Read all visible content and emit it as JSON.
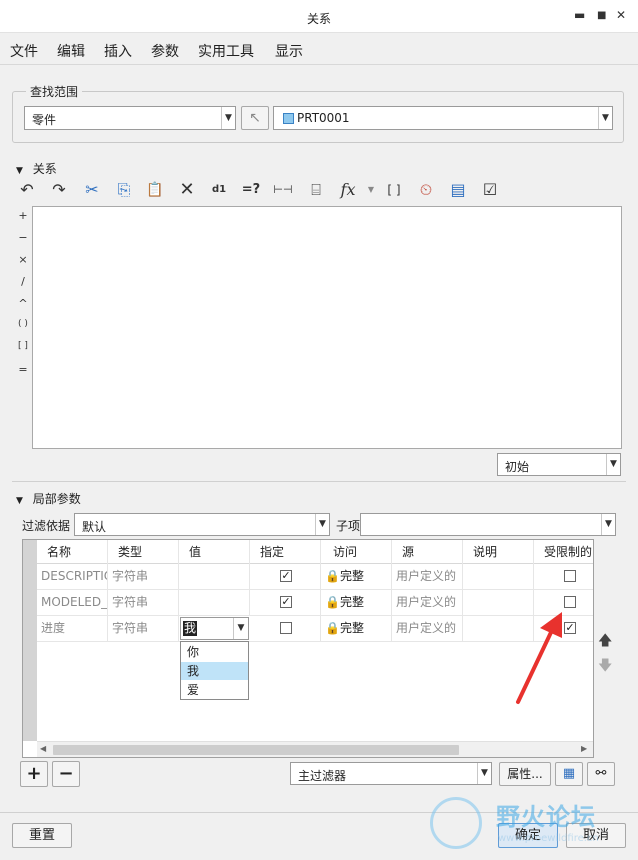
{
  "window": {
    "title": "关系",
    "min": "▬",
    "max": "■",
    "close": "✕"
  },
  "menu": [
    "文件",
    "编辑",
    "插入",
    "参数",
    "实用工具",
    "显示"
  ],
  "scope": {
    "legend": "查找范围",
    "type_value": "零件",
    "model_value": "PRT0001"
  },
  "relations": {
    "title": "关系",
    "toolbar": [
      "↶",
      "↷",
      "✂",
      "⎘",
      "📋",
      "✕",
      "d1",
      "=?",
      "⊢⊣",
      "⌸",
      "fx",
      "[ ]",
      "⏲",
      "▤",
      "☑"
    ],
    "operators": [
      "+",
      "−",
      "×",
      "/",
      "^",
      "( )",
      "[ ]",
      "="
    ],
    "mode_value": "初始"
  },
  "local_params": {
    "title": "局部参数",
    "filter_label": "过滤依据",
    "filter_value": "默认",
    "child_label": "子项",
    "child_value": "",
    "columns": [
      "名称",
      "类型",
      "值",
      "指定",
      "访问",
      "源",
      "说明",
      "受限制的"
    ],
    "rows": [
      {
        "name": "DESCRIPTIO",
        "type": "字符串",
        "value": "",
        "designated": true,
        "access": "完整",
        "source": "用户定义的",
        "desc": "",
        "restricted": false
      },
      {
        "name": "MODELED_",
        "type": "字符串",
        "value": "",
        "designated": true,
        "access": "完整",
        "source": "用户定义的",
        "desc": "",
        "restricted": false
      },
      {
        "name": "进度",
        "type": "字符串",
        "value": "我",
        "designated": false,
        "access": "完整",
        "source": "用户定义的",
        "desc": "",
        "restricted": true
      }
    ],
    "value_options": [
      "你",
      "我",
      "爱"
    ],
    "value_selected": "我",
    "main_filter": "主过滤器",
    "properties_btn": "属性...",
    "add": "+",
    "remove": "−"
  },
  "footer": {
    "reset": "重置",
    "ok": "确定",
    "cancel": "取消"
  },
  "watermark": {
    "brand": "野火论坛",
    "url": "www.proewildfire.cn"
  },
  "colors": {
    "selection": "#bfe3f8",
    "arrow": "#e8322e",
    "ok_button": "#dde9f5"
  }
}
